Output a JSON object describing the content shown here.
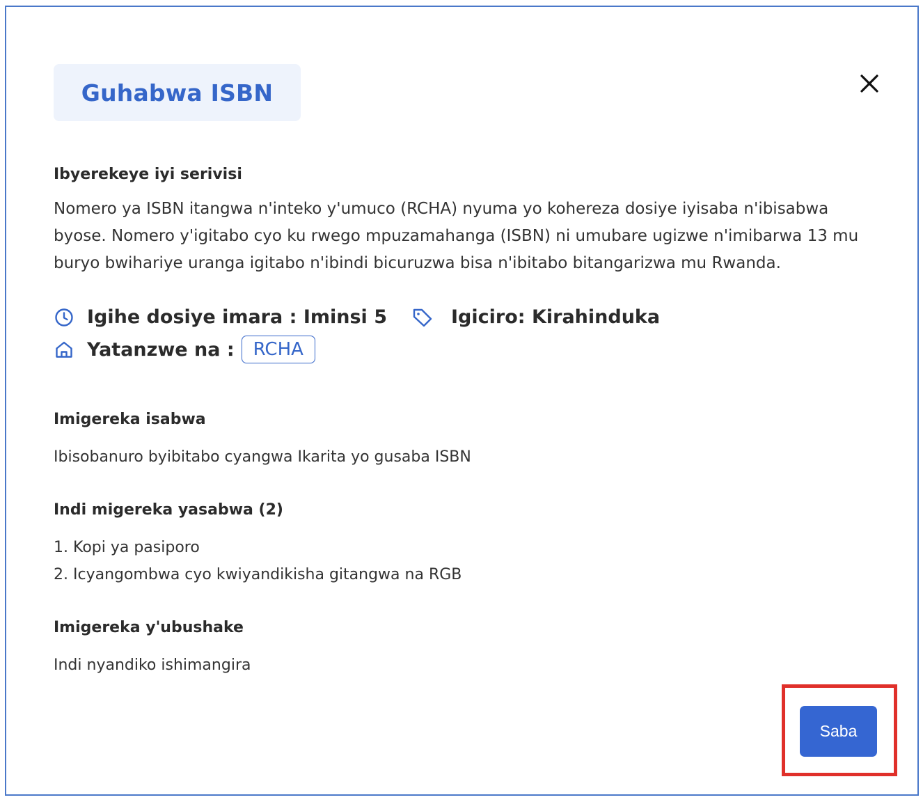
{
  "modal": {
    "title": "Guhabwa ISBN",
    "close_icon": "close-icon"
  },
  "about": {
    "heading": "Ibyerekeye iyi serivisi",
    "lines": [
      "Nomero ya ISBN itangwa n'inteko y'umuco (RCHA) nyuma yo kohereza dosiye iyisaba n'ibisabwa",
      "byose. Nomero y'igitabo cyo ku rwego mpuzamahanga (ISBN) ni umubare ugizwe n'imibarwa 13 mu",
      "buryo bwihariye uranga igitabo n'ibindi bicuruzwa bisa n'ibitabo bitangarizwa mu Rwanda."
    ]
  },
  "meta": {
    "duration": "Igihe dosiye imara : Iminsi 5",
    "price": "Igiciro: Kirahinduka",
    "provider_label": "Yatanzwe na :",
    "provider_badge": "RCHA",
    "icons": {
      "duration": "clock-icon",
      "price": "tag-icon",
      "provider": "home-icon"
    }
  },
  "required_docs": {
    "heading": "Imigereka isabwa",
    "items": [
      "Ibisobanuro byibitabo cyangwa Ikarita yo gusaba ISBN"
    ]
  },
  "other_docs": {
    "heading": "Indi migereka yasabwa (2)",
    "items": [
      "1. Kopi ya pasiporo",
      "2. Icyangombwa cyo kwiyandikisha gitangwa na RGB"
    ]
  },
  "optional_docs": {
    "heading": "Imigereka y'ubushake",
    "items": [
      "Indi nyandiko ishimangira"
    ]
  },
  "actions": {
    "apply_label": "Saba"
  },
  "colors": {
    "accent": "#3566c9",
    "chip_bg": "#eef3fc",
    "modal_border": "#4a78c9",
    "highlight": "#e0302a"
  }
}
